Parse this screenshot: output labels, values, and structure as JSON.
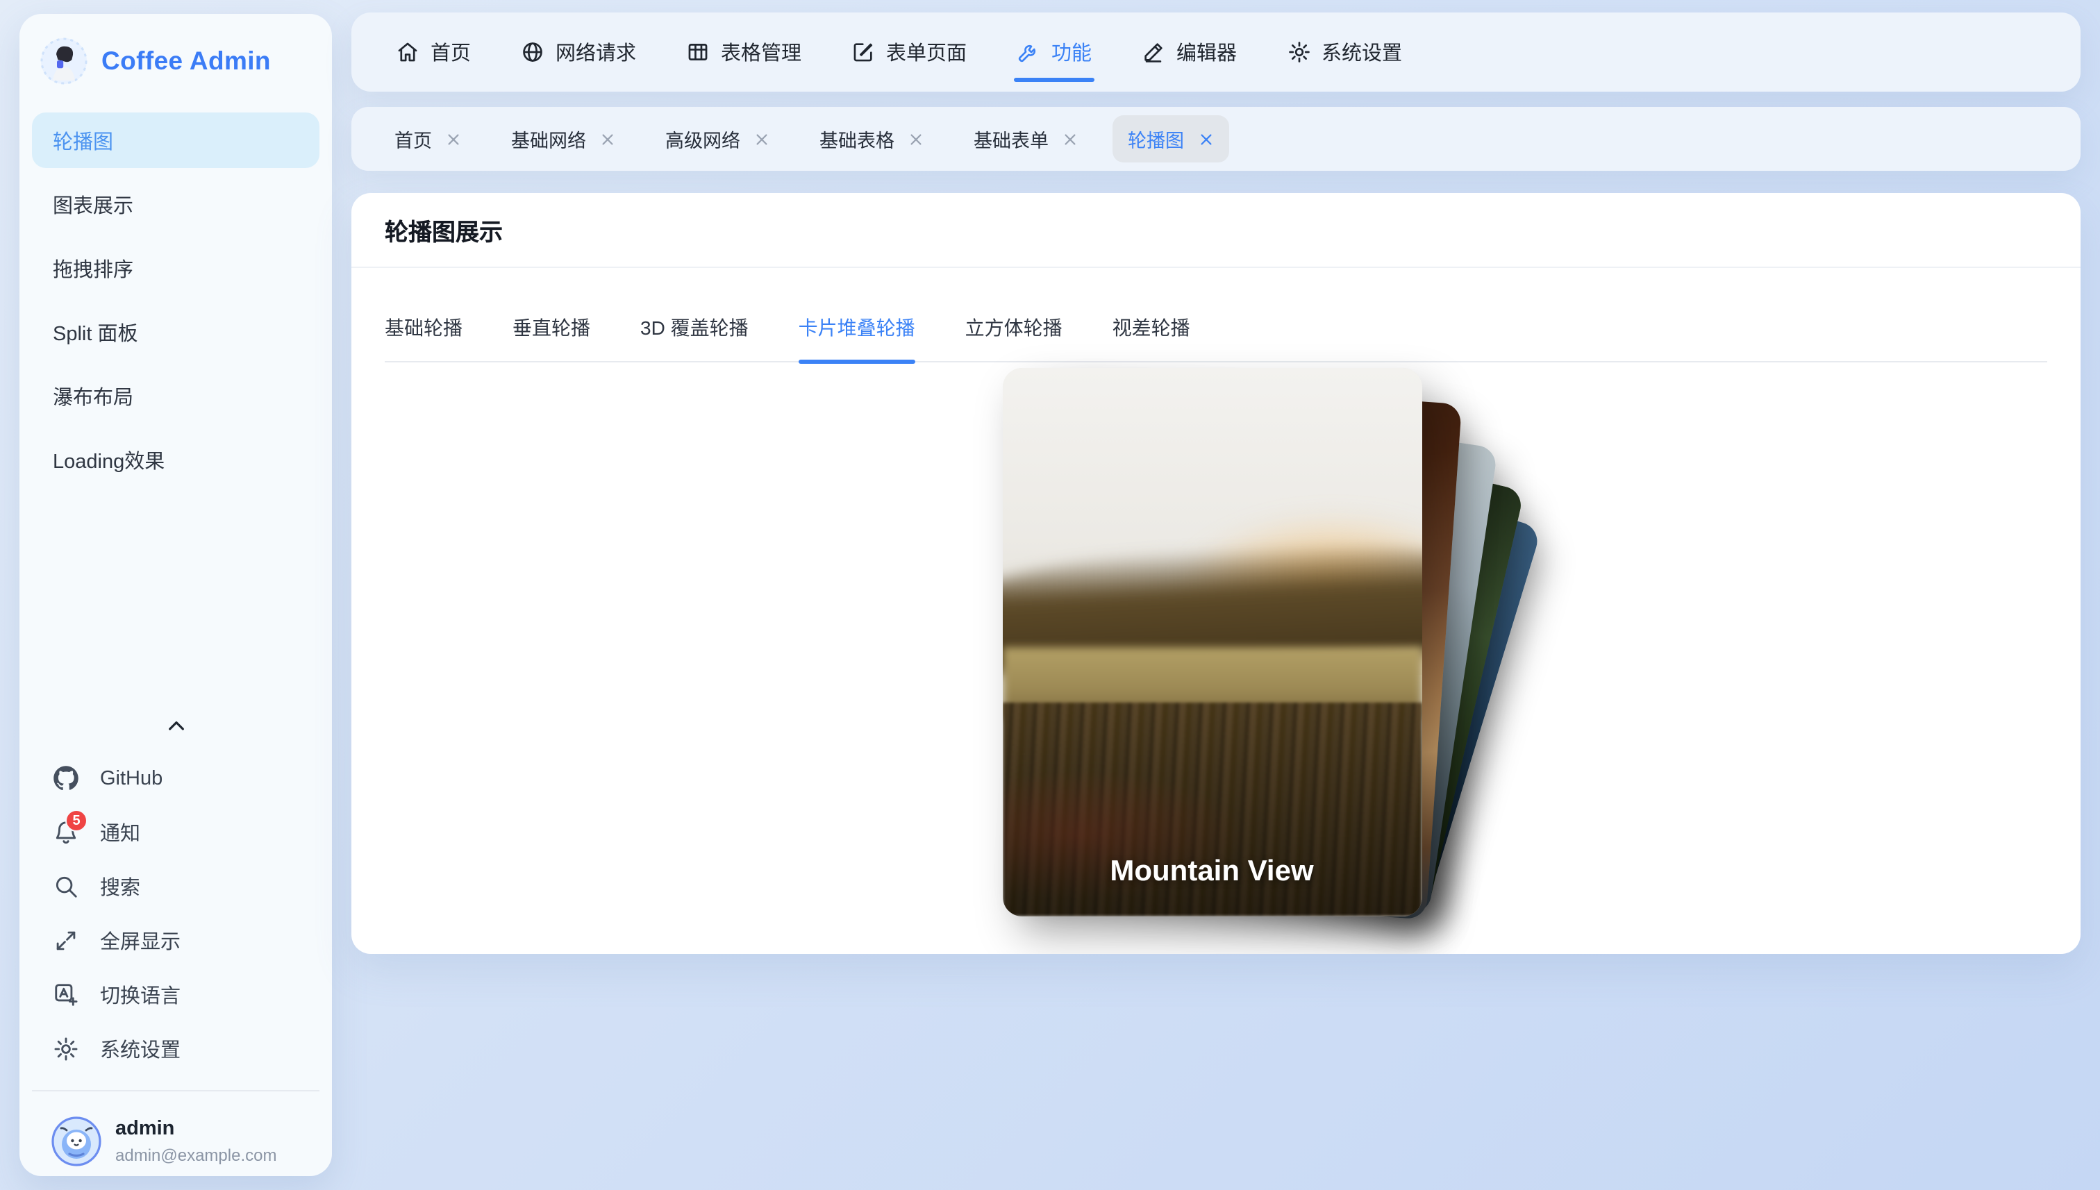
{
  "brand": {
    "title": "Coffee Admin",
    "logo_icon": "coffee-girl-avatar"
  },
  "colors": {
    "accent": "#3b82f6",
    "brand_blue": "#3b7cf6",
    "sidebar_active_bg": "#daeffb",
    "sidebar_active_text": "#4b93f0",
    "badge_red": "#ef4444",
    "panel_bg": "#edf3fb",
    "card_bg": "#ffffff"
  },
  "sidebar": {
    "items": [
      {
        "label": "轮播图",
        "active": true
      },
      {
        "label": "图表展示"
      },
      {
        "label": "拖拽排序"
      },
      {
        "label": "Split 面板"
      },
      {
        "label": "瀑布布局"
      },
      {
        "label": "Loading效果"
      }
    ],
    "footer": {
      "collapse_icon": "chevron-up-icon",
      "items": [
        {
          "label": "GitHub",
          "icon": "github-icon"
        },
        {
          "label": "通知",
          "icon": "bell-icon",
          "badge": "5"
        },
        {
          "label": "搜索",
          "icon": "search-icon"
        },
        {
          "label": "全屏显示",
          "icon": "fullscreen-icon"
        },
        {
          "label": "切换语言",
          "icon": "language-icon"
        },
        {
          "label": "系统设置",
          "icon": "gear-icon"
        }
      ],
      "user": {
        "name": "admin",
        "email": "admin@example.com",
        "avatar_icon": "mascot-avatar"
      }
    }
  },
  "topnav": {
    "items": [
      {
        "label": "首页",
        "icon": "home-icon"
      },
      {
        "label": "网络请求",
        "icon": "globe-icon"
      },
      {
        "label": "表格管理",
        "icon": "table-icon"
      },
      {
        "label": "表单页面",
        "icon": "form-icon"
      },
      {
        "label": "功能",
        "icon": "wrench-icon",
        "active": true
      },
      {
        "label": "编辑器",
        "icon": "pen-icon"
      },
      {
        "label": "系统设置",
        "icon": "gear-icon"
      }
    ]
  },
  "tagsbar": {
    "close_icon": "close-icon",
    "items": [
      {
        "label": "首页"
      },
      {
        "label": "基础网络"
      },
      {
        "label": "高级网络"
      },
      {
        "label": "基础表格"
      },
      {
        "label": "基础表单"
      },
      {
        "label": "轮播图",
        "active": true
      }
    ]
  },
  "main": {
    "title": "轮播图展示",
    "tabs": [
      {
        "label": "基础轮播"
      },
      {
        "label": "垂直轮播"
      },
      {
        "label": "3D 覆盖轮播"
      },
      {
        "label": "卡片堆叠轮播",
        "active": true
      },
      {
        "label": "立方体轮播"
      },
      {
        "label": "视差轮播"
      }
    ],
    "carousel": {
      "front_caption": "Mountain View"
    }
  }
}
